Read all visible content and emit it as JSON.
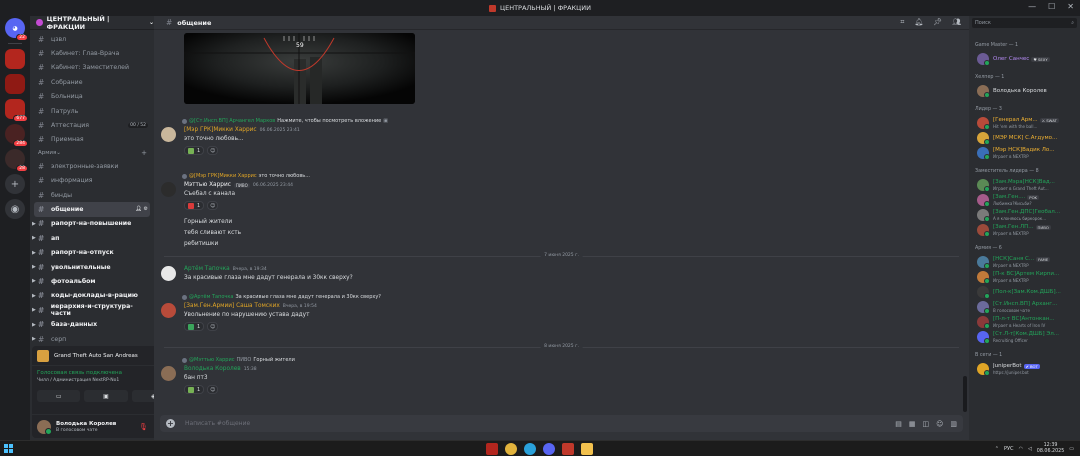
{
  "window": {
    "title": "ЦЕНТРАЛЬНЫЙ | ФРАКЦИИ",
    "controls": [
      "—",
      "☐",
      "✕"
    ]
  },
  "rail": {
    "badges": [
      "22",
      "677",
      "284",
      "28"
    ]
  },
  "guild": {
    "name": "ЦЕНТРАЛЬНЫЙ | ФРАКЦИИ"
  },
  "channels_top": [
    {
      "name": "цзвл"
    },
    {
      "name": "Кабинет: Глав-Врача"
    },
    {
      "name": "Кабинет: Заместителей"
    },
    {
      "name": "Собрание"
    },
    {
      "name": "Больница"
    },
    {
      "name": "Патруль"
    },
    {
      "name": "Аттестация",
      "tag": "00 / 52"
    },
    {
      "name": "Приемная"
    }
  ],
  "category": {
    "name": "Армия"
  },
  "channels_army": [
    {
      "name": "электронные-заявки"
    },
    {
      "name": "информация"
    },
    {
      "name": "бинды"
    },
    {
      "name": "общение",
      "active": true
    },
    {
      "name": "рапорт-на-повышение",
      "arrow": true,
      "unread": true
    },
    {
      "name": "ап",
      "arrow": true,
      "unread": true
    },
    {
      "name": "рапорт-на-отпуск",
      "arrow": true,
      "unread": true
    },
    {
      "name": "увольнительные",
      "arrow": true,
      "unread": true
    },
    {
      "name": "фотоальбом",
      "arrow": true,
      "unread": true
    },
    {
      "name": "коды-доклады-в-рацию",
      "arrow": true,
      "unread": true
    },
    {
      "name": "иерархия-и-структура-части",
      "arrow": true,
      "unread": true
    },
    {
      "name": "база-данных",
      "arrow": true,
      "unread": true
    },
    {
      "name": "серп",
      "arrow": true
    }
  ],
  "panel": {
    "game": "Grand Theft Auto San Andreas",
    "voice_title": "Голосовая связь подключена",
    "voice_sub": "Чилл / Администрация NextRP-No1",
    "user_name": "Володька Королев",
    "user_status": "В голосовом чате"
  },
  "chat": {
    "channel": "общение",
    "image_counter": "59",
    "divider1": "7 июня 2025 г.",
    "divider2": "8 июня 2025 г.",
    "composer_placeholder": "Написать #общение"
  },
  "messages": [
    {
      "reply_name": "@[Ст.Инсп.ВП] Арчангел Марков",
      "reply_text": "Нажмите, чтобы посмотреть вложение",
      "name": "[Мэр ГРК]Микки Харрис",
      "ts": "06.06.2025 23:41",
      "lines": [
        "это точно любовь..."
      ],
      "react_count": "1"
    },
    {
      "reply_name": "@[Мэр ГРК]Микки Харрис",
      "reply_text": "это точно любовь...",
      "name": "Мэттью Харрис",
      "badge": "ПИВО",
      "ts": "06.06.2025 23:44",
      "lines": [
        "Съебал с канала"
      ],
      "react_count": "1",
      "extra_lines": [
        "Горный жители",
        "тебя сливают ксть",
        "ребитишки"
      ]
    },
    {
      "name": "Артём Тапочка",
      "ts": "Вчера, в 19:34",
      "lines": [
        "За красивые глаза мне дадут генерала и 30кк сверху?"
      ]
    },
    {
      "reply_name": "@Артём Тапочка",
      "reply_text": "За красивые глаза мне дадут генерала и 30кк сверху?",
      "name": "[Зам.Ген.Армии] Саша Томских",
      "ts": "Вчера, в 19:54",
      "lines": [
        "Увольнение по нарушению устава дадут"
      ],
      "react_count": "1"
    },
    {
      "reply_name": "@Мэттью Харрис",
      "reply_badge": "ПИВО",
      "reply_text": "Горный жители",
      "name": "Володька Королев",
      "ts": "15:38",
      "lines": [
        "бан пт3"
      ],
      "react_count": "1"
    }
  ],
  "members": {
    "search_placeholder": "Поиск",
    "sections": [
      {
        "title": "Game Master — 1",
        "items": [
          {
            "name": "Олег Санчес",
            "tag": "♥ SEXY",
            "color": "p"
          }
        ]
      },
      {
        "title": "Хелпер — 1",
        "items": [
          {
            "name": "Володька Королев",
            "color": "w"
          }
        ]
      },
      {
        "title": "Лидер — 3",
        "items": [
          {
            "name": "[Генерал Арм...",
            "tag": "⚔ SWAT",
            "status": "Hit 'em with the ball...",
            "color": "y"
          },
          {
            "name": "[МЭР МСК] С.Агдумо...",
            "color": "y"
          },
          {
            "name": "[Мэр НСК]Вадик Ло...",
            "status": "Играет в NEXTRP",
            "color": "y"
          }
        ]
      },
      {
        "title": "Заместитель лидера — 8",
        "items": [
          {
            "name": "[Зам.Мэра[НСК]Вад...",
            "status": "Играет в Grand Theft Aut...",
            "color": "g"
          },
          {
            "name": "[Зам.Ген....",
            "tag": "POK",
            "status": "Любимка?Кисьби?",
            "color": "g"
          },
          {
            "name": "[Зам.Ген.ДПС]Геобал...",
            "status": "А я клоняюсь биркорок...",
            "color": "g"
          },
          {
            "name": "[Зам.Ген.ЛП...",
            "tag": "ПИВО",
            "status": "Играет в NEXTRP",
            "color": "g"
          }
        ]
      },
      {
        "title": "Армия — 6",
        "items": [
          {
            "name": "[НСК]Саня С...",
            "tag": "FAME",
            "status": "Играет в NEXTRP",
            "color": "g"
          },
          {
            "name": "[П-к ВС]Артем Кирпи...",
            "status": "Играет в NEXTRP",
            "color": "g"
          },
          {
            "name": "[Пол-к[Зам.Ком.ДШБ]...",
            "color": "g"
          },
          {
            "name": "[Ст.Инсп.ВП] Арханг...",
            "status": "В голосовом чате",
            "color": "g"
          },
          {
            "name": "[П-л-т ВС]Антонкан...",
            "status": "Играет в Hearts of Iron IV",
            "color": "g"
          },
          {
            "name": "[Ст.Л-т[Ком.ДШБ] Эл...",
            "status": "Recruiting Officer",
            "color": "g"
          }
        ]
      },
      {
        "title": "В сети — 1",
        "items": [
          {
            "name": "JuniperBot",
            "tag": "✔ BOT",
            "status": "https://juniper.bot",
            "color": "w"
          }
        ]
      }
    ]
  },
  "taskbar": {
    "time": "12:39",
    "date": "08.06.2025",
    "lang": "РУС"
  }
}
